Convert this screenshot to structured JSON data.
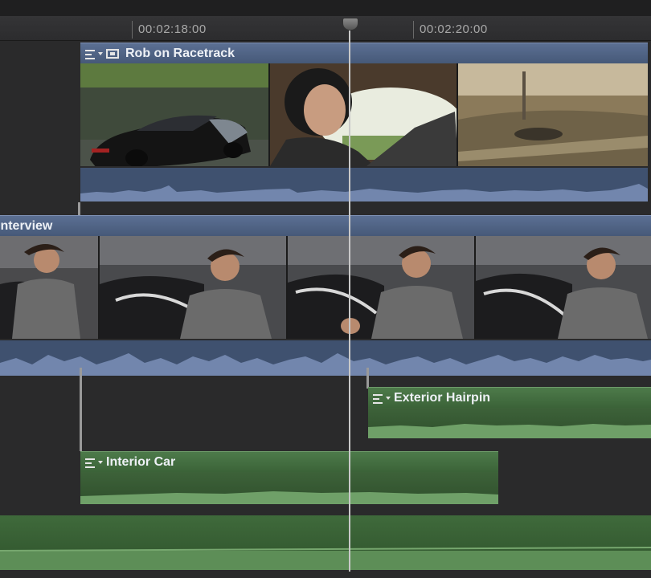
{
  "ruler": {
    "timecodes": [
      "00:02:18:00",
      "00:02:20:00"
    ]
  },
  "clips": {
    "rob": {
      "title": "Rob on Racetrack"
    },
    "interview": {
      "title": "Interview"
    },
    "exterior": {
      "title": "Exterior Hairpin"
    },
    "interior": {
      "title": "Interior Car"
    }
  },
  "colors": {
    "video_clip_blue": "#5b6f93",
    "audio_waveform_blue": "#7286ad",
    "connected_clip_green": "#4d7a4a",
    "waveform_green": "#6fa068",
    "playhead": "#c9c9c9"
  },
  "icons": [
    "clip-menu-icon",
    "video-clip-icon",
    "playhead-icon"
  ]
}
